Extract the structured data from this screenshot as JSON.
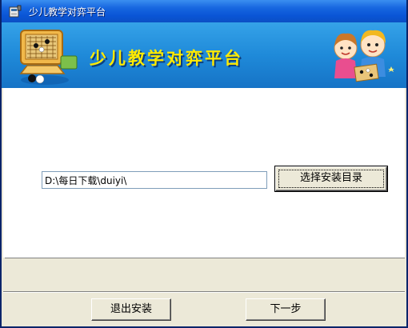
{
  "window": {
    "title": "少儿教学对弈平台"
  },
  "banner": {
    "title": "少儿教学对弈平台"
  },
  "install": {
    "path_value": "D:\\每日下载\\duiyi\\",
    "browse_label": "选择安装目录"
  },
  "footer": {
    "exit_label": "退出安装",
    "next_label": "下一步"
  },
  "icons": {
    "app": "installer-icon",
    "banner_left": "go-board-computer-icon",
    "banner_right": "kids-mascot-icon"
  },
  "colors": {
    "titlebar": "#0a55d6",
    "banner": "#1f8ad9",
    "banner_title": "#ffea00",
    "dialog_bg": "#ece9d8"
  }
}
